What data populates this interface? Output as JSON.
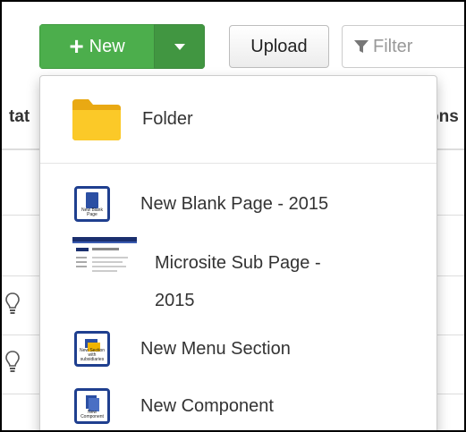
{
  "toolbar": {
    "new_label": "New",
    "upload_label": "Upload",
    "filter_placeholder": "Filter"
  },
  "table": {
    "col_left_partial": "tat",
    "col_right_partial": "ons"
  },
  "menu": {
    "items": [
      {
        "label": "Folder",
        "icon": "folder-icon"
      },
      {
        "label": "New Blank Page - 2015",
        "icon": "blank-page-icon",
        "icon_caption": "New Blank Page"
      },
      {
        "label_line1": "Microsite Sub Page -",
        "label_line2": "2015",
        "icon": "microsite-thumbnail-icon"
      },
      {
        "label": "New Menu Section",
        "icon": "menu-section-icon",
        "icon_caption": "New Section with subsidiaries"
      },
      {
        "label": "New Component",
        "icon": "component-icon",
        "icon_caption": "New Component"
      }
    ]
  },
  "colors": {
    "accent_green": "#4cae4c",
    "folder_yellow": "#f9c31f",
    "icon_blue": "#1f3f8f"
  }
}
